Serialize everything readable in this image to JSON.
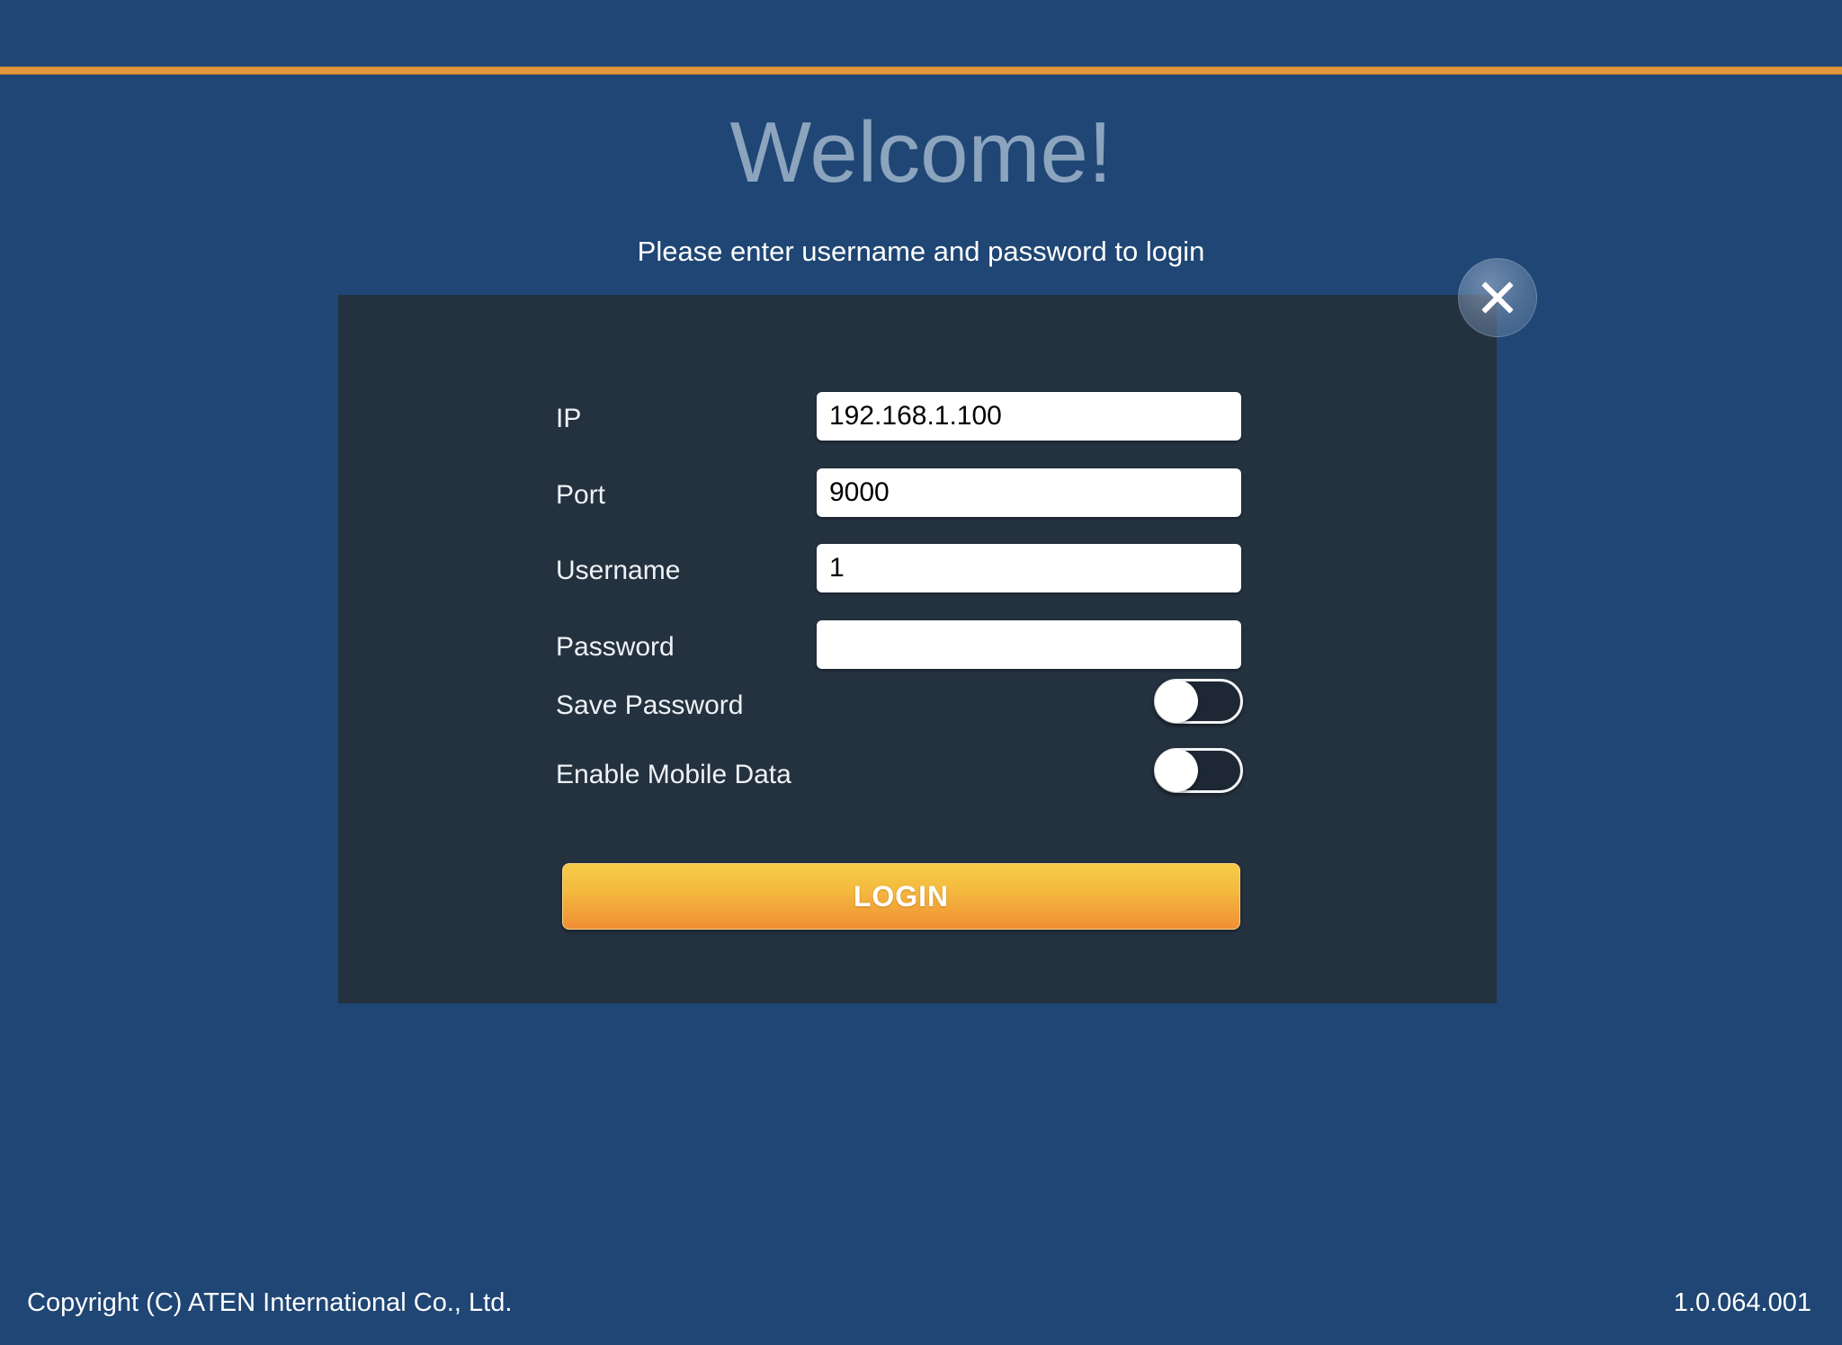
{
  "theme": {
    "background_color": "#1f4674",
    "panel_color": "#24313f",
    "accent_color": "#e2983a",
    "title_color": "#8ca4bd",
    "text_color": "#ffffff"
  },
  "header": {
    "title": "Welcome!",
    "subtitle": "Please enter username and password to login"
  },
  "close_button": {
    "icon": "close-icon",
    "label": "×"
  },
  "form": {
    "fields": [
      {
        "label": "IP",
        "value": "192.168.1.100",
        "placeholder": ""
      },
      {
        "label": "Port",
        "value": "9000",
        "placeholder": ""
      },
      {
        "label": "Username",
        "value": "1",
        "placeholder": ""
      },
      {
        "label": "Password",
        "value": "",
        "placeholder": ""
      }
    ],
    "toggles": [
      {
        "label": "Save Password",
        "state": "off"
      },
      {
        "label": "Enable Mobile Data",
        "state": "off"
      }
    ],
    "submit_label": "LOGIN"
  },
  "footer": {
    "copyright": "Copyright (C) ATEN International Co., Ltd.",
    "version": "1.0.064.001"
  }
}
